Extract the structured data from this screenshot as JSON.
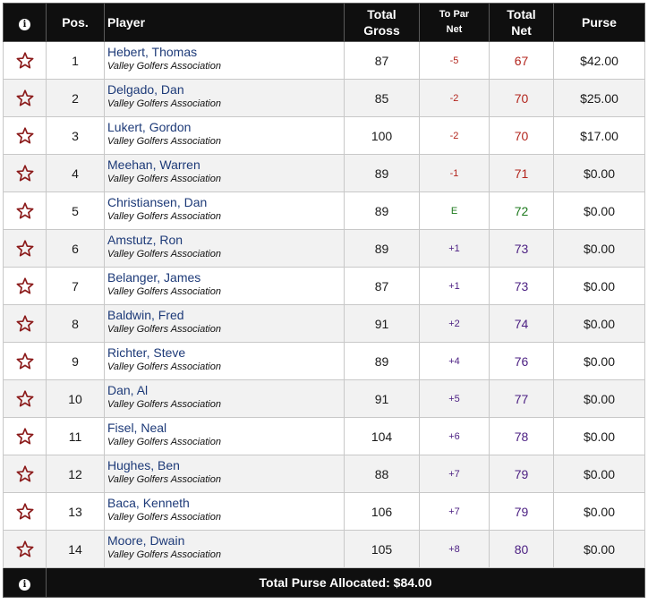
{
  "header": {
    "info_icon": "info-icon",
    "pos": "Pos.",
    "player": "Player",
    "total_gross_1": "Total",
    "total_gross_2": "Gross",
    "to_par_1": "To Par",
    "to_par_2": "Net",
    "total_net_1": "Total",
    "total_net_2": "Net",
    "purse": "Purse"
  },
  "colors": {
    "header_bg": "#0f0f0f",
    "star": "#8b1a1a",
    "under_par": "#b3261e",
    "even_par": "#1e7a1e",
    "over_par": "#4b1f82",
    "player_name": "#1d3a78"
  },
  "rows": [
    {
      "pos": "1",
      "name": "Hebert, Thomas",
      "assoc": "Valley Golfers Association",
      "gross": "87",
      "topar": "-5",
      "net": "67",
      "purse": "$42.00",
      "status": "neg"
    },
    {
      "pos": "2",
      "name": "Delgado, Dan",
      "assoc": "Valley Golfers Association",
      "gross": "85",
      "topar": "-2",
      "net": "70",
      "purse": "$25.00",
      "status": "neg"
    },
    {
      "pos": "3",
      "name": "Lukert, Gordon",
      "assoc": "Valley Golfers Association",
      "gross": "100",
      "topar": "-2",
      "net": "70",
      "purse": "$17.00",
      "status": "neg"
    },
    {
      "pos": "4",
      "name": "Meehan, Warren",
      "assoc": "Valley Golfers Association",
      "gross": "89",
      "topar": "-1",
      "net": "71",
      "purse": "$0.00",
      "status": "neg"
    },
    {
      "pos": "5",
      "name": "Christiansen, Dan",
      "assoc": "Valley Golfers Association",
      "gross": "89",
      "topar": "E",
      "net": "72",
      "purse": "$0.00",
      "status": "even"
    },
    {
      "pos": "6",
      "name": "Amstutz, Ron",
      "assoc": "Valley Golfers Association",
      "gross": "89",
      "topar": "+1",
      "net": "73",
      "purse": "$0.00",
      "status": "pos"
    },
    {
      "pos": "7",
      "name": "Belanger, James",
      "assoc": "Valley Golfers Association",
      "gross": "87",
      "topar": "+1",
      "net": "73",
      "purse": "$0.00",
      "status": "pos"
    },
    {
      "pos": "8",
      "name": "Baldwin, Fred",
      "assoc": "Valley Golfers Association",
      "gross": "91",
      "topar": "+2",
      "net": "74",
      "purse": "$0.00",
      "status": "pos"
    },
    {
      "pos": "9",
      "name": "Richter, Steve",
      "assoc": "Valley Golfers Association",
      "gross": "89",
      "topar": "+4",
      "net": "76",
      "purse": "$0.00",
      "status": "pos"
    },
    {
      "pos": "10",
      "name": "Dan, Al",
      "assoc": "Valley Golfers Association",
      "gross": "91",
      "topar": "+5",
      "net": "77",
      "purse": "$0.00",
      "status": "pos"
    },
    {
      "pos": "11",
      "name": "Fisel, Neal",
      "assoc": "Valley Golfers Association",
      "gross": "104",
      "topar": "+6",
      "net": "78",
      "purse": "$0.00",
      "status": "pos"
    },
    {
      "pos": "12",
      "name": "Hughes, Ben",
      "assoc": "Valley Golfers Association",
      "gross": "88",
      "topar": "+7",
      "net": "79",
      "purse": "$0.00",
      "status": "pos"
    },
    {
      "pos": "13",
      "name": "Baca, Kenneth",
      "assoc": "Valley Golfers Association",
      "gross": "106",
      "topar": "+7",
      "net": "79",
      "purse": "$0.00",
      "status": "pos"
    },
    {
      "pos": "14",
      "name": "Moore, Dwain",
      "assoc": "Valley Golfers Association",
      "gross": "105",
      "topar": "+8",
      "net": "80",
      "purse": "$0.00",
      "status": "pos"
    }
  ],
  "footer": {
    "info_icon": "info-icon",
    "total_purse": "Total Purse Allocated: $84.00"
  }
}
